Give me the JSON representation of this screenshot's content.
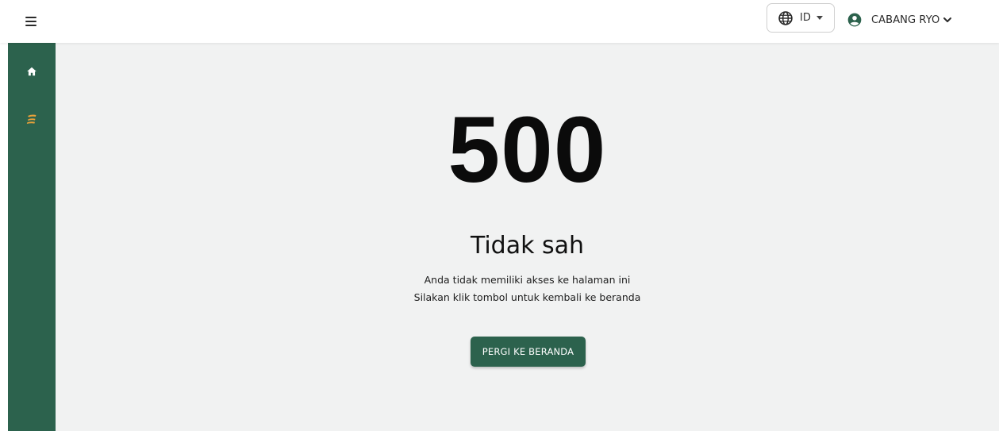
{
  "header": {
    "menu_icon": "hamburger-menu-icon",
    "language": {
      "code": "ID",
      "icon": "globe-icon"
    },
    "user": {
      "name": "CABANG RYO",
      "icon": "account-circle-icon"
    }
  },
  "sidebar": {
    "items": [
      {
        "icon": "home-icon"
      },
      {
        "icon": "brand-logo-icon"
      }
    ]
  },
  "error": {
    "code": "500",
    "title": "Tidak sah",
    "message_line1": "Anda tidak memiliki akses ke halaman ini",
    "message_line2": "Silakan klik tombol untuk kembali ke beranda",
    "button_label": "PERGI KE BERANDA"
  },
  "colors": {
    "primary": "#2c624d",
    "background": "#f1f2f2",
    "logo_accent": "#e8a13a"
  }
}
